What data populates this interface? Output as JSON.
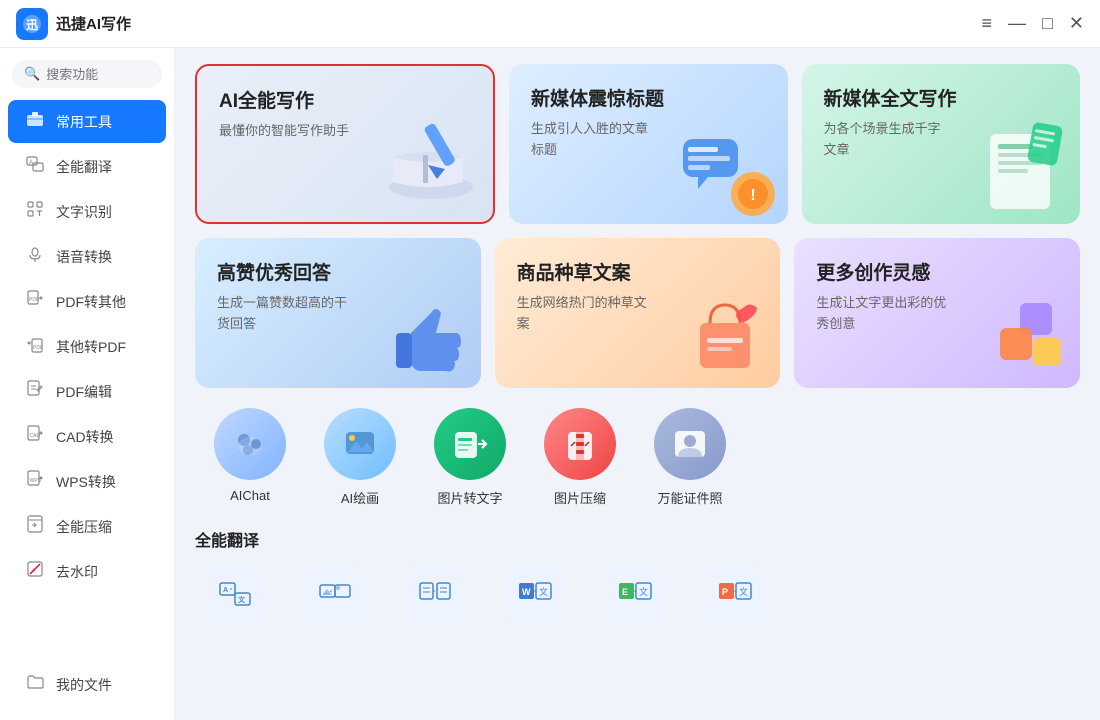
{
  "titleBar": {
    "title": "迅捷AI写作",
    "controls": [
      "≡",
      "—",
      "□",
      "×"
    ]
  },
  "sidebar": {
    "search": {
      "placeholder": "搜索功能"
    },
    "items": [
      {
        "id": "common-tools",
        "label": "常用工具",
        "active": true,
        "icon": "🧰"
      },
      {
        "id": "full-translate",
        "label": "全能翻译",
        "icon": "🔤"
      },
      {
        "id": "ocr",
        "label": "文字识别",
        "icon": "🔡"
      },
      {
        "id": "voice-convert",
        "label": "语音转换",
        "icon": "🎙️"
      },
      {
        "id": "pdf-other",
        "label": "PDF转其他",
        "icon": "📄"
      },
      {
        "id": "other-pdf",
        "label": "其他转PDF",
        "icon": "📄"
      },
      {
        "id": "pdf-edit",
        "label": "PDF编辑",
        "icon": "✏️"
      },
      {
        "id": "cad-convert",
        "label": "CAD转换",
        "icon": "📐"
      },
      {
        "id": "wps-convert",
        "label": "WPS转换",
        "icon": "📝"
      },
      {
        "id": "compress",
        "label": "全能压缩",
        "icon": "🗜️"
      },
      {
        "id": "watermark",
        "label": "去水印",
        "icon": "💧"
      }
    ],
    "bottomItems": [
      {
        "id": "my-files",
        "label": "我的文件",
        "icon": "📁"
      }
    ]
  },
  "topCards": [
    {
      "id": "ai-writing",
      "title": "AI全能写作",
      "desc": "最懂你的智能写作助手",
      "bgFrom": "#e8edf8",
      "bgTo": "#d5e0f5",
      "selected": true
    },
    {
      "id": "new-media-title",
      "title": "新媒体震惊标题",
      "desc": "生成引人入胜的文章标题",
      "bgFrom": "#deeeff",
      "bgTo": "#b5d5ff"
    },
    {
      "id": "new-media-full",
      "title": "新媒体全文写作",
      "desc": "为各个场景生成千字文章",
      "bgFrom": "#d5f5e8",
      "bgTo": "#9fe5c5"
    }
  ],
  "midCards": [
    {
      "id": "high-praise",
      "title": "高赞优秀回答",
      "desc": "生成一篇赞数超高的干货回答",
      "bgFrom": "#d8eeff",
      "bgTo": "#b0ccf5"
    },
    {
      "id": "product-grass",
      "title": "商品种草文案",
      "desc": "生成网络热门的种草文案",
      "bgFrom": "#ffecd8",
      "bgTo": "#ffcca0"
    },
    {
      "id": "more-ideas",
      "title": "更多创作灵感",
      "desc": "生成让文字更出彩的优秀创意",
      "bgFrom": "#eae0ff",
      "bgTo": "#d0b8ff"
    }
  ],
  "iconRow": [
    {
      "id": "ai-chat",
      "label": "AIChat",
      "bg": "#d0e8ff",
      "emoji": "💬",
      "color": "#4a90e2"
    },
    {
      "id": "ai-draw",
      "label": "AI绘画",
      "bg": "#c8e8ff",
      "emoji": "🖼️",
      "color": "#5ba8e8"
    },
    {
      "id": "img-to-text",
      "label": "图片转文字",
      "bg": "#20c060",
      "emoji": "📋",
      "color": "#20c060"
    },
    {
      "id": "img-compress",
      "label": "图片压缩",
      "bg": "#e03030",
      "emoji": "🗜️",
      "color": "#e03030"
    },
    {
      "id": "id-photo",
      "label": "万能证件照",
      "bg": "#8888cc",
      "emoji": "👤",
      "color": "#8888cc"
    }
  ],
  "sectionTitle": "全能翻译",
  "bottomIcons": [
    {
      "id": "translate-1",
      "emoji": "🔤",
      "bg": "#eef4ff"
    },
    {
      "id": "translate-2",
      "emoji": "🖼️",
      "bg": "#eef4ff"
    },
    {
      "id": "translate-3",
      "emoji": "📄",
      "bg": "#eef4ff"
    },
    {
      "id": "translate-4",
      "emoji": "📝",
      "bg": "#eef4ff"
    },
    {
      "id": "translate-5",
      "emoji": "📊",
      "bg": "#eef4ff"
    },
    {
      "id": "translate-6",
      "emoji": "📑",
      "bg": "#eef4ff"
    }
  ]
}
